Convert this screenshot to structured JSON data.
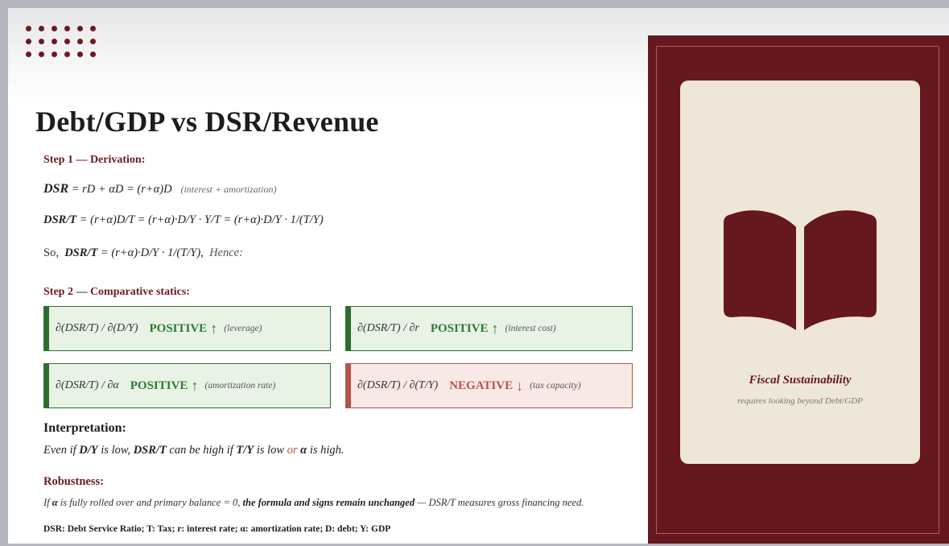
{
  "title": "Debt/GDP vs DSR/Revenue",
  "step1": {
    "label": "Step 1 — Derivation:",
    "eq1": {
      "lhs": "DSR",
      "rhs": " = rD + αD = (r+α)D",
      "note": "(interest + amortization)"
    },
    "eq2": {
      "lhs": "DSR/T",
      "rhs": " = (r+α)D/T = (r+α)·D/Y · Y/T = (r+α)·D/Y · 1/(T/Y)"
    },
    "eq3": {
      "prefix": "So,",
      "lhs": "DSR/T",
      "rhs": " = (r+α)·D/Y · 1/(T/Y),",
      "suffix": "Hence:"
    }
  },
  "step2": {
    "label": "Step 2 — Comparative statics:",
    "boxes": [
      {
        "expr": "∂(DSR/T) / ∂(D/Y)",
        "sign": "POSITIVE",
        "arrow": "↑",
        "note": "(leverage)"
      },
      {
        "expr": "∂(DSR/T) / ∂r",
        "sign": "POSITIVE",
        "arrow": "↑",
        "note": "(interest cost)"
      },
      {
        "expr": "∂(DSR/T) / ∂α",
        "sign": "POSITIVE",
        "arrow": "↑",
        "note": "(amortization rate)"
      },
      {
        "expr": "∂(DSR/T) / ∂(T/Y)",
        "sign": "NEGATIVE",
        "arrow": "↓",
        "note": "(tax capacity)"
      }
    ]
  },
  "interpretation": {
    "heading": "Interpretation:",
    "t1": "Even if ",
    "b1": "D/Y",
    "t2": " is low, ",
    "b2": "DSR/T",
    "t3": " can be high if ",
    "b3": "T/Y",
    "t4": " is low ",
    "or": "or",
    "t5": " ",
    "b4": "α",
    "t6": " is high."
  },
  "robustness": {
    "heading": "Robustness:",
    "t1": "If ",
    "b1": "α",
    "t2": " is fully rolled over and primary balance = 0, ",
    "b2": "the formula and signs remain unchanged",
    "t3": " — DSR/T measures gross financing need."
  },
  "legend": "DSR: Debt Service Ratio; T: Tax; r: interest rate; α: amortization rate; D: debt; Y: GDP",
  "panel": {
    "icon": "open-book-icon",
    "title": "Fiscal Sustainability",
    "subtitle": "requires looking beyond Debt/GDP"
  },
  "colors": {
    "maroon": "#65181e",
    "positive": "#2d7a31",
    "negative": "#b5534a",
    "card": "#efe6da"
  }
}
